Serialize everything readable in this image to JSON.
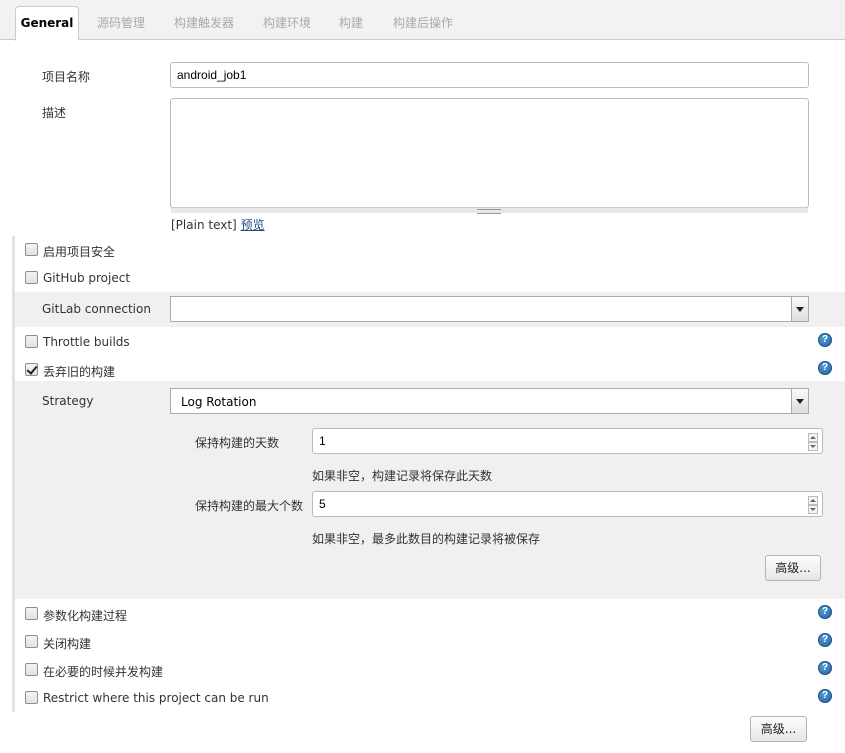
{
  "tabs": [
    {
      "label": "General"
    },
    {
      "label": "源码管理"
    },
    {
      "label": "构建触发器"
    },
    {
      "label": "构建环境"
    },
    {
      "label": "构建"
    },
    {
      "label": "构建后操作"
    }
  ],
  "project_name": {
    "label": "项目名称",
    "value": "android_job1"
  },
  "description": {
    "label": "描述",
    "value": "",
    "format_text": "[Plain text]",
    "preview_link": "预览"
  },
  "options": {
    "enable_security": {
      "label": "启用项目安全",
      "checked": false
    },
    "github_project": {
      "label": "GitHub project",
      "checked": false
    },
    "gitlab_connection": {
      "label": "GitLab connection",
      "value": ""
    },
    "throttle_builds": {
      "label": "Throttle builds",
      "checked": false
    },
    "discard_old_builds": {
      "label": "丢弃旧的构建",
      "checked": true
    },
    "parameterized": {
      "label": "参数化构建过程",
      "checked": false
    },
    "disable_build": {
      "label": "关闭构建",
      "checked": false
    },
    "concurrent_builds": {
      "label": "在必要的时候并发构建",
      "checked": false
    },
    "restrict_where": {
      "label": "Restrict where this project can be run",
      "checked": false
    }
  },
  "strategy": {
    "label": "Strategy",
    "value": "Log Rotation",
    "days_to_keep": {
      "label": "保持构建的天数",
      "value": "1",
      "hint": "如果非空，构建记录将保存此天数"
    },
    "max_builds": {
      "label": "保持构建的最大个数",
      "value": "5",
      "hint": "如果非空，最多此数目的构建记录将被保存"
    },
    "advanced_label": "高级..."
  },
  "bottom_advanced_label": "高级...",
  "help_icon_text": "?",
  "colors": {
    "accent_link": "#204a87",
    "help_icon": "#1f5e9e",
    "tab_bar": "#f2f2f2"
  }
}
